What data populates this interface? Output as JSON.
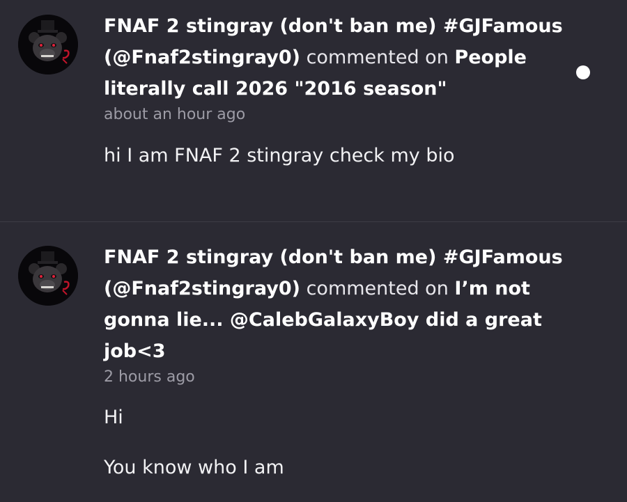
{
  "notifications": [
    {
      "author": "FNAF 2 stingray (don't ban me) #GJFamous (@Fnaf2stingray0)",
      "verb": "commented on",
      "post_title": "People literally call 2026 \"2016 season\"",
      "time": "about an hour ago",
      "body": [
        "hi I am FNAF 2 stingray check my bio"
      ],
      "unread": true,
      "avatar_icon": "fnaf-bear-avatar-icon"
    },
    {
      "author": "FNAF 2 stingray (don't ban me) #GJFamous (@Fnaf2stingray0)",
      "verb": "commented on",
      "post_title": "I’m not gonna lie... @CalebGalaxyBoy did a great job<3",
      "time": "2 hours ago",
      "body": [
        "Hi",
        "You know who I am"
      ],
      "unread": false,
      "avatar_icon": "fnaf-bear-avatar-icon"
    }
  ],
  "colors": {
    "background": "#2b2a33",
    "divider": "#3e3d46",
    "timestamp": "#9d9ca6",
    "unread_dot": "#ffffff"
  }
}
